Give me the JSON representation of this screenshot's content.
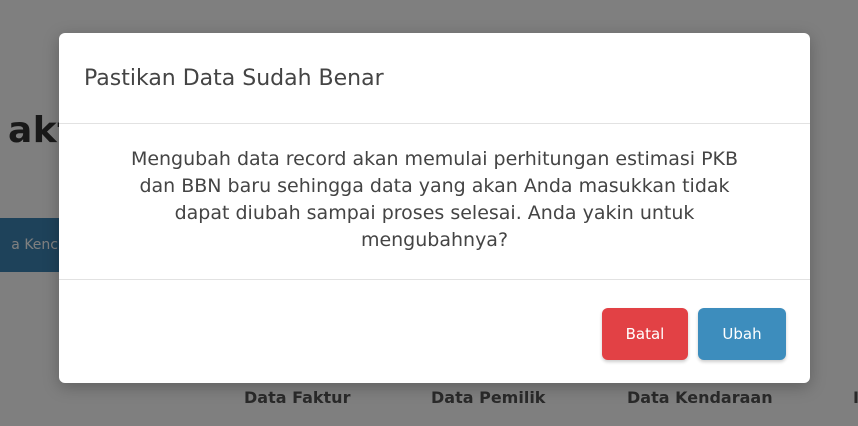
{
  "background": {
    "heading_fragment": "aktu",
    "tab_fragment": "a Kenc",
    "steps": [
      "Data Faktur",
      "Data Pemilik",
      "Data Kendaraan",
      "I"
    ]
  },
  "modal": {
    "title": "Pastikan Data Sudah Benar",
    "lines": [
      "Mengubah data record akan memulai perhitungan estimasi PKB",
      "dan BBN baru sehingga data yang akan Anda masukkan tidak",
      "dapat diubah sampai proses selesai. Anda yakin untuk",
      "mengubahnya?"
    ],
    "cancel_label": "Batal",
    "confirm_label": "Ubah"
  },
  "colors": {
    "cancel": "#e24145",
    "confirm": "#3d8dbd",
    "tab": "#3d85b4"
  }
}
